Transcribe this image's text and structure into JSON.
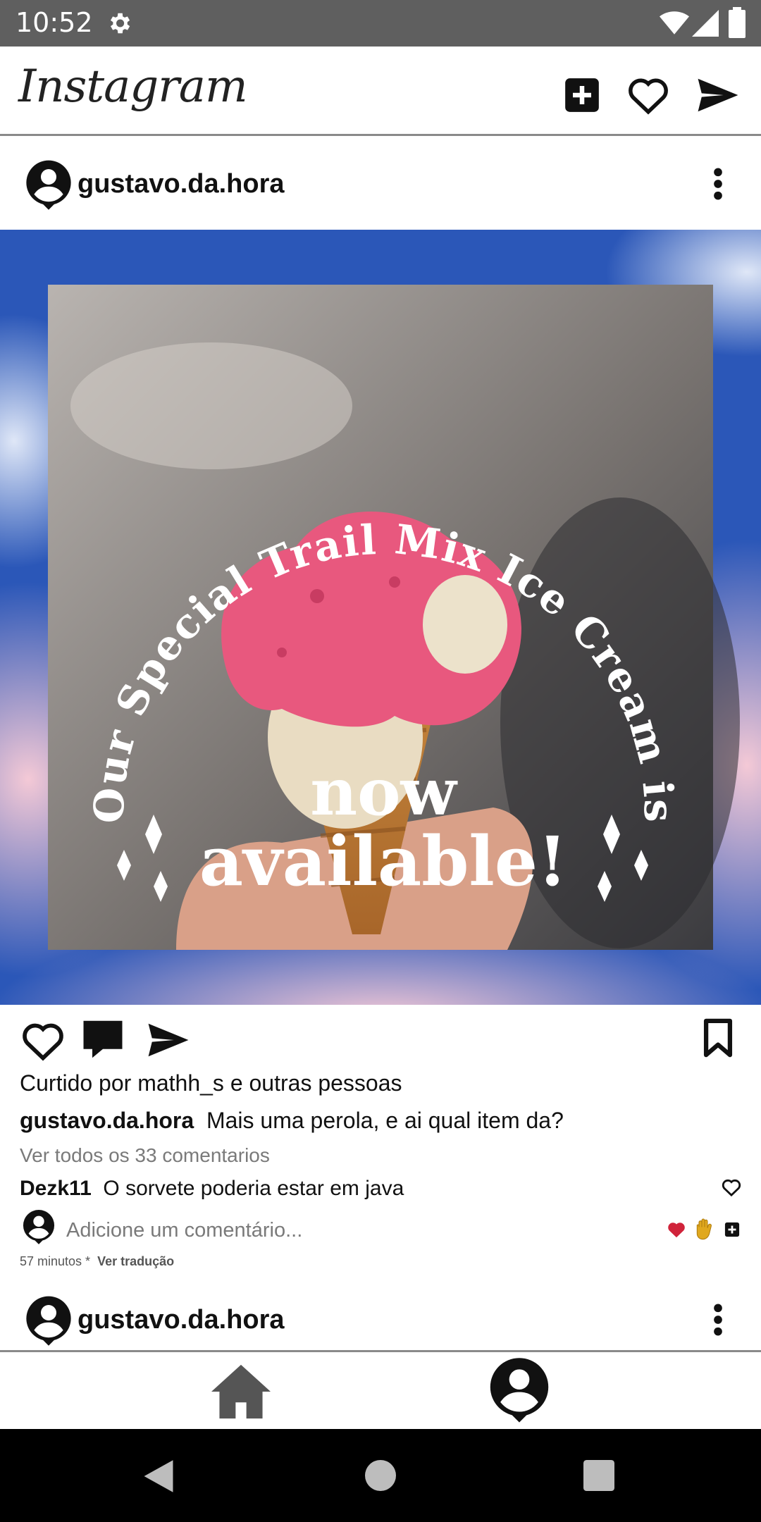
{
  "status_bar": {
    "time": "10:52"
  },
  "app": {
    "logo": "Instagram"
  },
  "post": {
    "username": "gustavo.da.hora",
    "image_text": {
      "arc": "Our Special Trail Mix Ice Cream is",
      "line1": "now",
      "line2": "available!"
    },
    "liked_by": "Curtido por mathh_s e outras pessoas",
    "caption_user": "gustavo.da.hora",
    "caption_text": "Mais uma perola, e ai qual item da?",
    "view_comments": "Ver todos os 33 comentarios",
    "comment_user": "Dezk11",
    "comment_text": "O sorvete poderia estar em java",
    "add_comment_placeholder": "Adicione um comentário...",
    "time_ago": "57 minutos *",
    "translate": "Ver tradução"
  },
  "next_post": {
    "username": "gustavo.da.hora"
  },
  "icons": {
    "settings": "gear-icon",
    "wifi": "wifi-icon",
    "signal": "signal-icon",
    "battery": "battery-icon",
    "new_post": "add-square-icon",
    "activity": "heart-outline-icon",
    "direct": "paper-plane-icon",
    "more": "more-vertical-icon",
    "like": "heart-outline-icon",
    "comment": "comment-icon",
    "share": "paper-plane-icon",
    "save": "bookmark-icon",
    "home": "home-icon",
    "profile": "profile-icon"
  },
  "colors": {
    "status_bar": "#5f5f5f",
    "sky": "#2b57b8",
    "cream_pink": "#e8587e",
    "heart_red": "#d0233a"
  }
}
